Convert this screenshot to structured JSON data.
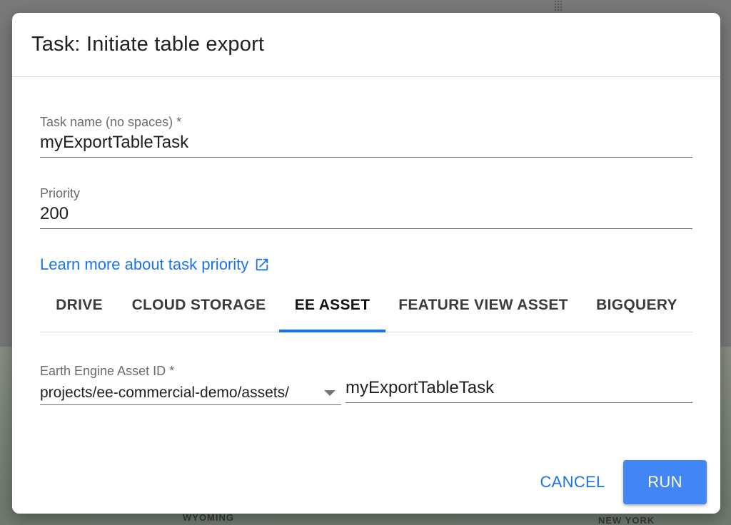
{
  "background": {
    "map_labels": [
      "WYOMING",
      "NEW YORK"
    ]
  },
  "dialog": {
    "title": "Task: Initiate table export",
    "task_name": {
      "label": "Task name (no spaces) *",
      "value": "myExportTableTask"
    },
    "priority": {
      "label": "Priority",
      "value": "200"
    },
    "learn_more_link": "Learn more about task priority",
    "tabs": [
      {
        "label": "DRIVE",
        "active": false
      },
      {
        "label": "CLOUD STORAGE",
        "active": false
      },
      {
        "label": "EE ASSET",
        "active": true
      },
      {
        "label": "FEATURE VIEW ASSET",
        "active": false
      },
      {
        "label": "BIGQUERY",
        "active": false
      }
    ],
    "asset": {
      "label": "Earth Engine Asset ID *",
      "prefix": "projects/ee-commercial-demo/assets/",
      "name": "myExportTableTask"
    },
    "buttons": {
      "cancel": "CANCEL",
      "run": "RUN"
    }
  },
  "colors": {
    "accent": "#1a73e8",
    "run_button": "#4285f4"
  },
  "icons": {
    "learn_more": "open-in-new-icon",
    "asset_dropdown": "caret-down-icon"
  }
}
